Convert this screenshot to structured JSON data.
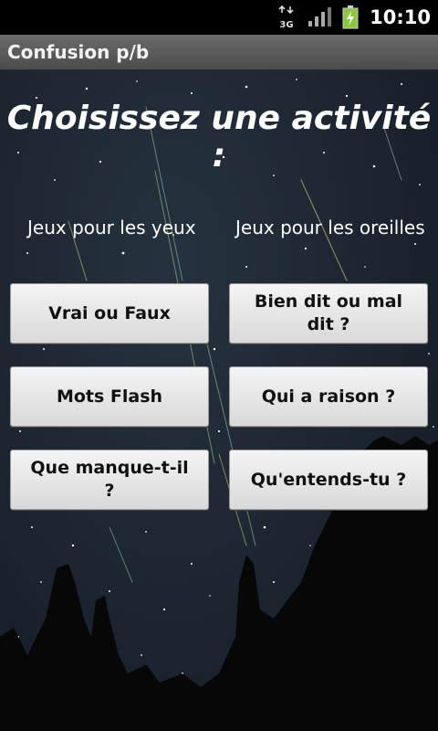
{
  "status_bar": {
    "time": "10:10",
    "network_type": "3G",
    "icons": [
      "network-3g-icon",
      "signal-strength-icon",
      "battery-charging-icon"
    ]
  },
  "title_bar": {
    "title": "Confusion p/b"
  },
  "main": {
    "heading": "Choisissez une activité :",
    "columns": [
      {
        "label": "Jeux pour les yeux",
        "buttons": [
          "Vrai ou Faux",
          "Mots Flash",
          "Que manque-t-il ?"
        ]
      },
      {
        "label": "Jeux pour les oreilles",
        "buttons": [
          "Bien dit ou mal dit ?",
          "Qui a raison ?",
          "Qu'entends-tu ?"
        ]
      }
    ]
  },
  "colors": {
    "status_bar_bg": "#000000",
    "title_bar_bg": "#5a5a5a",
    "background": "#1b2530",
    "button_bg": "#e6e6e6",
    "button_text": "#111111",
    "battery_charging": "#8dc63f"
  }
}
